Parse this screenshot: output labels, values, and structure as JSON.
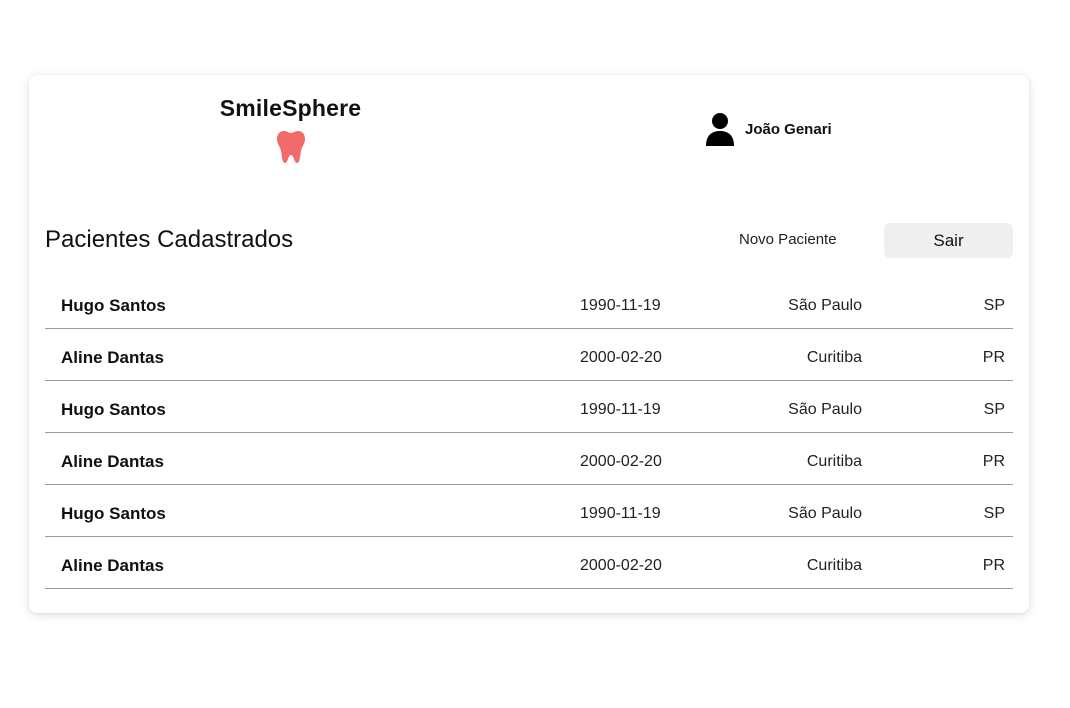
{
  "brand": {
    "name": "SmileSphere",
    "icon": "tooth-icon",
    "icon_color": "#F26A6A"
  },
  "user": {
    "name": "João Genari",
    "icon": "user-icon"
  },
  "section": {
    "title": "Pacientes Cadastrados",
    "new_patient_label": "Novo Paciente",
    "logout_label": "Sair"
  },
  "patients": [
    {
      "name": "Hugo Santos",
      "birth_date": "1990-11-19",
      "city": "São Paulo",
      "state": "SP"
    },
    {
      "name": "Aline Dantas",
      "birth_date": "2000-02-20",
      "city": "Curitiba",
      "state": "PR"
    },
    {
      "name": "Hugo Santos",
      "birth_date": "1990-11-19",
      "city": "São Paulo",
      "state": "SP"
    },
    {
      "name": "Aline Dantas",
      "birth_date": "2000-02-20",
      "city": "Curitiba",
      "state": "PR"
    },
    {
      "name": "Hugo Santos",
      "birth_date": "1990-11-19",
      "city": "São Paulo",
      "state": "SP"
    },
    {
      "name": "Aline Dantas",
      "birth_date": "2000-02-20",
      "city": "Curitiba",
      "state": "PR"
    }
  ]
}
